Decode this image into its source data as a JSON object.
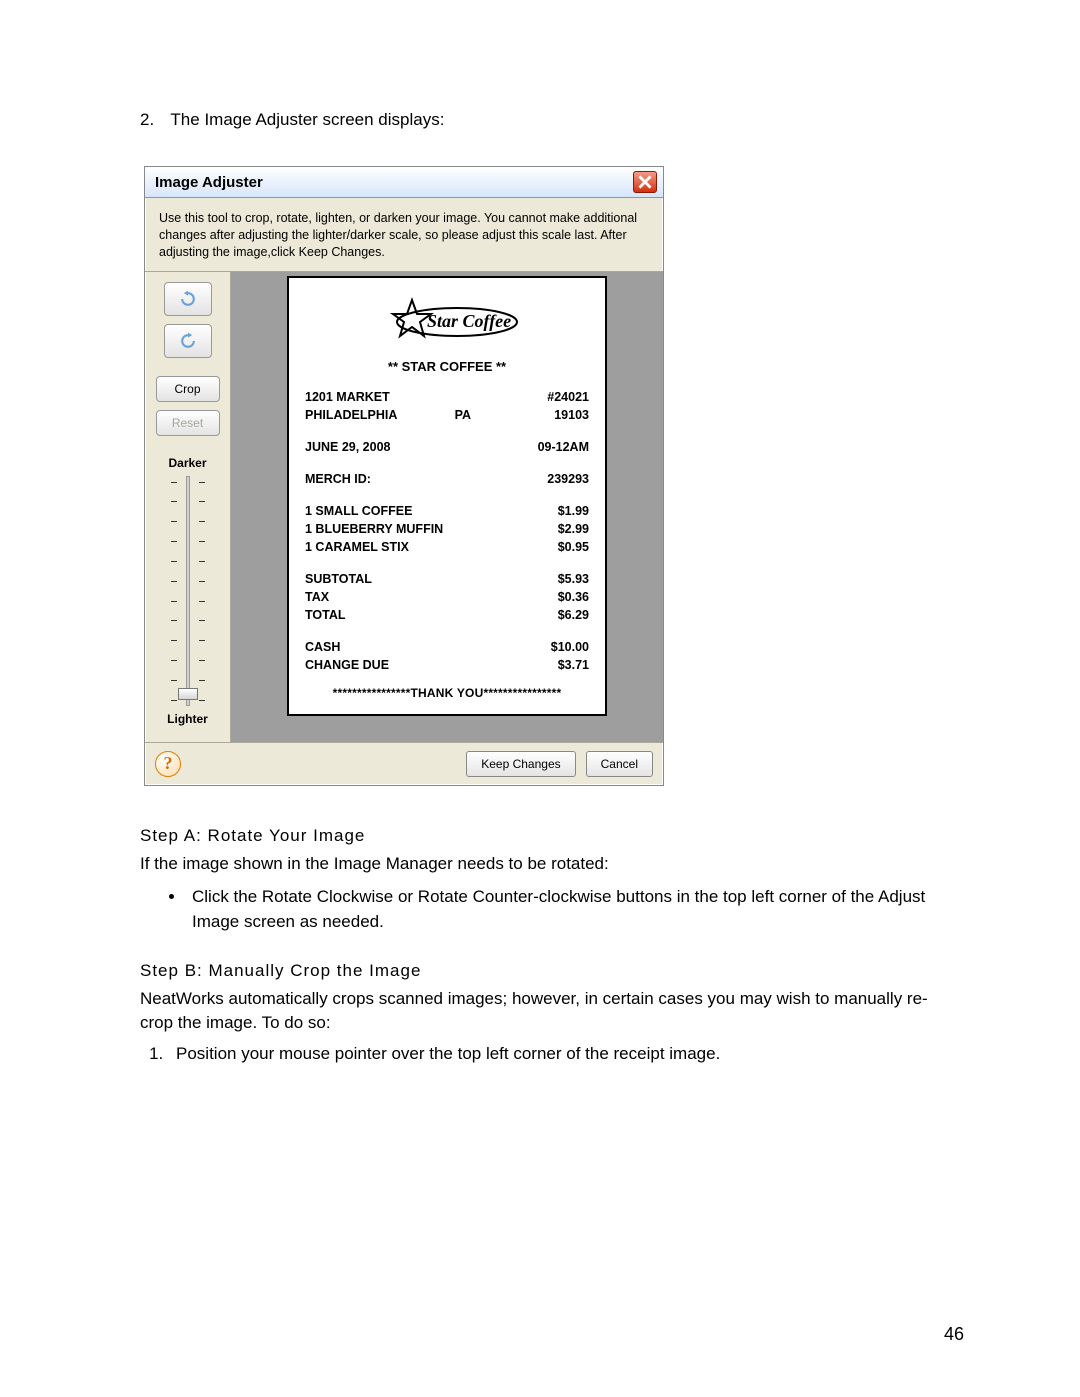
{
  "intro": {
    "num": "2.",
    "text": "The Image Adjuster screen displays:"
  },
  "dialog": {
    "title": "Image Adjuster",
    "instruction": "Use this tool to crop, rotate, lighten, or darken your image. You cannot make additional changes after adjusting the lighter/darker scale, so please adjust this scale last. After adjusting the image,click Keep Changes.",
    "crop_label": "Crop",
    "reset_label": "Reset",
    "darker_label": "Darker",
    "lighter_label": "Lighter",
    "keep_label": "Keep Changes",
    "cancel_label": "Cancel",
    "help_glyph": "?"
  },
  "receipt": {
    "logo_text": "Star Coffee",
    "headline": "** STAR COFFEE **",
    "addr1_left": "1201 MARKET",
    "addr1_right": "#24021",
    "addr2_left": "PHILADELPHIA",
    "addr2_mid": "PA",
    "addr2_right": "19103",
    "date_left": "JUNE 29, 2008",
    "date_right": "09-12AM",
    "merch_label": "MERCH ID:",
    "merch_val": "239293",
    "items": [
      {
        "name": "1 SMALL COFFEE",
        "price": "$1.99"
      },
      {
        "name": "1 BLUEBERRY MUFFIN",
        "price": "$2.99"
      },
      {
        "name": "1 CARAMEL STIX",
        "price": "$0.95"
      }
    ],
    "subtotal_label": "SUBTOTAL",
    "subtotal_val": "$5.93",
    "tax_label": "TAX",
    "tax_val": "$0.36",
    "total_label": "TOTAL",
    "total_val": "$6.29",
    "cash_label": "CASH",
    "cash_val": "$10.00",
    "change_label": "CHANGE DUE",
    "change_val": "$3.71",
    "thank": "****************THANK YOU****************"
  },
  "stepA": {
    "heading": "Step A: Rotate Your Image",
    "lead": "If the image shown in the Image Manager needs to be rotated:",
    "bullet": "Click the Rotate Clockwise or Rotate Counter-clockwise buttons in the top left corner of the Adjust Image screen as needed."
  },
  "stepB": {
    "heading": "Step B: Manually Crop the Image",
    "lead": "NeatWorks automatically crops scanned images; however, in certain cases you may wish to manually re-crop the image. To do so:",
    "step1": "Position your mouse pointer over the top left corner of the receipt image."
  },
  "page_number": "46"
}
